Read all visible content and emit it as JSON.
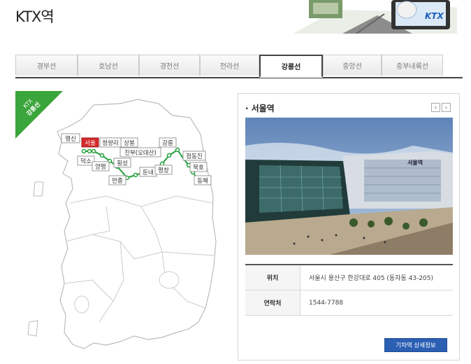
{
  "page": {
    "title": "KTX역",
    "logo_text": "KTX"
  },
  "tabs": [
    {
      "label": "경부선",
      "active": false
    },
    {
      "label": "호남선",
      "active": false
    },
    {
      "label": "경전선",
      "active": false
    },
    {
      "label": "전라선",
      "active": false
    },
    {
      "label": "강릉선",
      "active": true
    },
    {
      "label": "중앙선",
      "active": false
    },
    {
      "label": "중부내륙선",
      "active": false
    }
  ],
  "map": {
    "ribbon_line1": "KTX",
    "ribbon_line2": "강릉선",
    "line_color": "#22a03a",
    "selected_station": "서울",
    "stations": [
      "행신",
      "서울",
      "청량리",
      "상봉",
      "덕소",
      "양평",
      "만종",
      "횡성",
      "둔내",
      "진부(오대산)",
      "평창",
      "강릉",
      "정동진",
      "묵호",
      "동해"
    ]
  },
  "station_panel": {
    "title": "서울역",
    "prev_icon": "‹",
    "next_icon": "›",
    "rows": [
      {
        "label": "위치",
        "value": "서울시 용산구 한강대로 405 (동자동 43-205)"
      },
      {
        "label": "연락처",
        "value": "1544-7788"
      }
    ],
    "photo_sign": "서울역",
    "detail_button": "기차역 상세정보"
  }
}
